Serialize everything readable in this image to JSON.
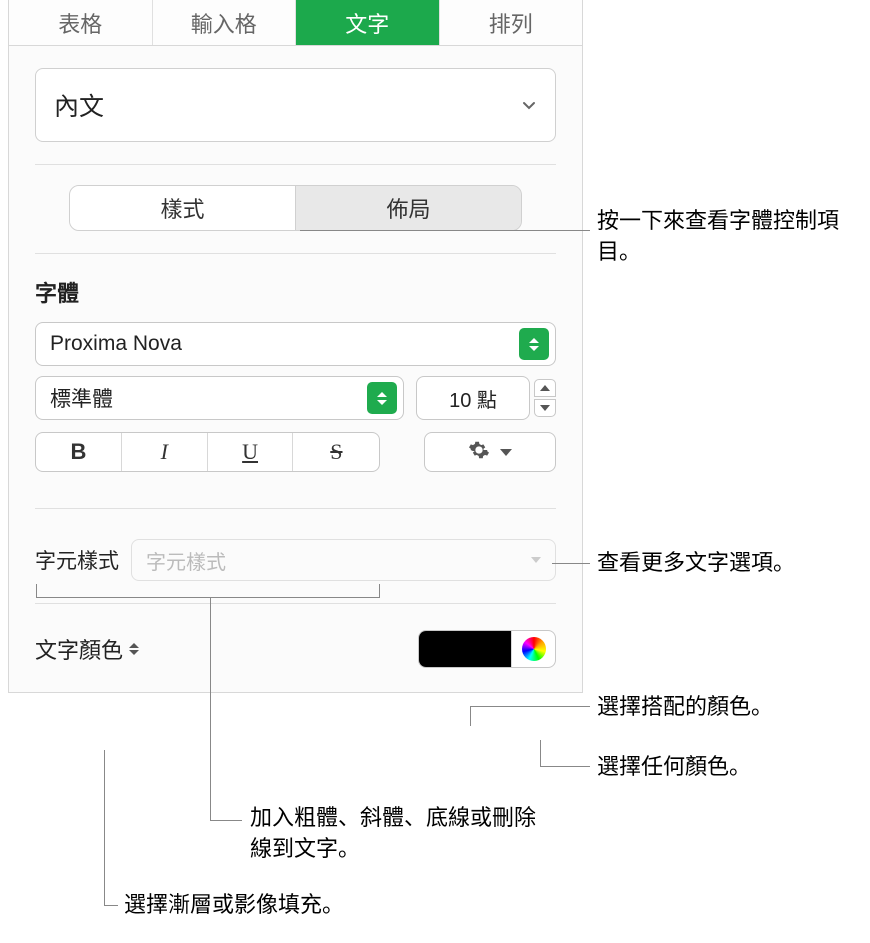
{
  "tabs": {
    "table": "表格",
    "cell": "輸入格",
    "text": "文字",
    "arrange": "排列"
  },
  "paragraphStyle": {
    "label": "內文"
  },
  "segmented": {
    "style": "樣式",
    "layout": "佈局"
  },
  "font": {
    "sectionLabel": "字體",
    "family": "Proxima Nova",
    "weight": "標準體",
    "size": "10 點",
    "bold": "B",
    "italic": "I",
    "underline": "U",
    "strike": "S"
  },
  "characterStyle": {
    "label": "字元樣式",
    "placeholder": "字元樣式"
  },
  "textColor": {
    "label": "文字顏色",
    "swatch": "#000000"
  },
  "callouts": {
    "styleControls": "按一下來查看字體控制項目。",
    "moreOptions": "查看更多文字選項。",
    "matchColor": "選擇搭配的顏色。",
    "anyColor": "選擇任何顏色。",
    "bius": "加入粗體、斜體、底線或刪除線到文字。",
    "gradient": "選擇漸層或影像填充。"
  }
}
